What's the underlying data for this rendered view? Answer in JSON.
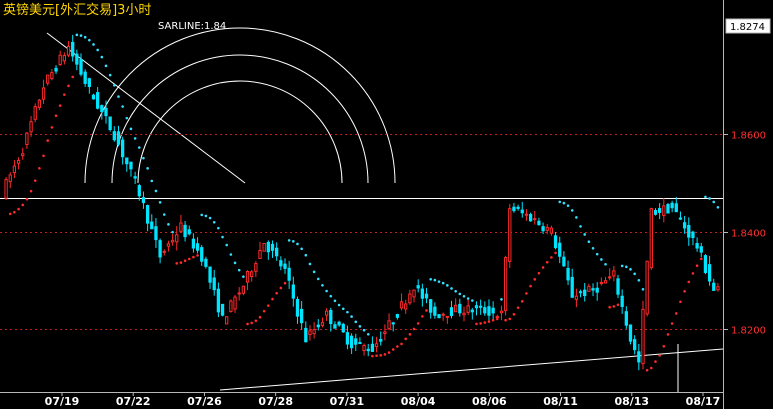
{
  "window": {
    "title": "英镑美元[外汇交易]3小时"
  },
  "indicator": {
    "label": "SARLINE:1.84"
  },
  "colors": {
    "background": "#000000",
    "axis": "#b8b8b8",
    "grid": "#c02020",
    "up": "#ff2a2a",
    "down": "#00e5ff",
    "sar_up": "#ff2a2a",
    "sar_down": "#33e0ff",
    "drawing": "#ffffff",
    "title": "#ffd700"
  },
  "chart_data": {
    "type": "candlestick",
    "x_tick_labels": [
      "07/19",
      "07/22",
      "07/26",
      "07/28",
      "07/31",
      "08/04",
      "08/06",
      "08/11",
      "08/13",
      "08/17"
    ],
    "y_ticks": [
      "1.8600",
      "1.8400",
      "1.8200"
    ],
    "current_price": "1.8274",
    "ylim": [
      1.8075,
      1.8835
    ],
    "horizontal_line": 1.847,
    "grid": "dotted-horizontal",
    "series_waypoints": [
      [
        0,
        1.848
      ],
      [
        5,
        1.857
      ],
      [
        10,
        1.87
      ],
      [
        16,
        1.878
      ],
      [
        21,
        1.869
      ],
      [
        27,
        1.86
      ],
      [
        33,
        1.848
      ],
      [
        38,
        1.835
      ],
      [
        43,
        1.841
      ],
      [
        48,
        1.835
      ],
      [
        53,
        1.822
      ],
      [
        58,
        1.829
      ],
      [
        63,
        1.838
      ],
      [
        68,
        1.832
      ],
      [
        73,
        1.818
      ],
      [
        78,
        1.823
      ],
      [
        84,
        1.817
      ],
      [
        89,
        1.816
      ],
      [
        94,
        1.822
      ],
      [
        99,
        1.829
      ],
      [
        104,
        1.823
      ],
      [
        109,
        1.824
      ],
      [
        115,
        1.824
      ],
      [
        120,
        1.823
      ],
      [
        122,
        1.845
      ],
      [
        127,
        1.843
      ],
      [
        132,
        1.84
      ],
      [
        137,
        1.827
      ],
      [
        142,
        1.828
      ],
      [
        147,
        1.831
      ],
      [
        151,
        1.818
      ],
      [
        153,
        1.813
      ],
      [
        156,
        1.844
      ],
      [
        161,
        1.845
      ],
      [
        167,
        1.837
      ],
      [
        171,
        1.828
      ]
    ]
  }
}
